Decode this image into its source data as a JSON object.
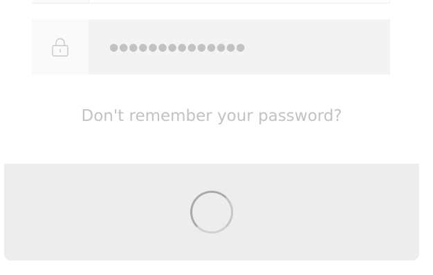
{
  "login": {
    "password_field": {
      "value_masked": "●●●●●●●●●●●●●●",
      "icon": "lock-icon"
    },
    "forgot_password_link": "Don't remember your password?",
    "submit_button": {
      "state": "loading",
      "icon": "loading-spinner-icon"
    }
  },
  "colors": {
    "field_bg": "#f3f3f3",
    "icon_cell_bg": "#fafafa",
    "button_bg": "#ededed",
    "muted_text": "#c2c2c2"
  }
}
